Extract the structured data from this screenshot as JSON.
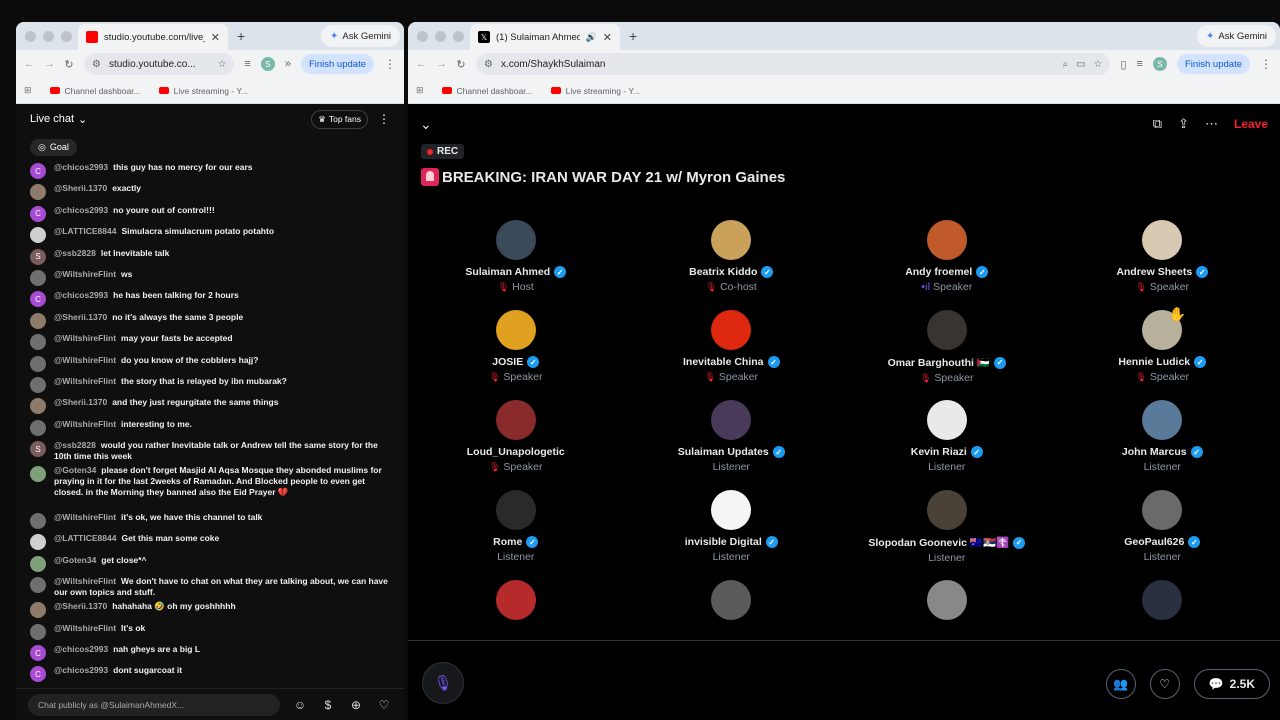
{
  "left_window": {
    "tab_title": "studio.youtube.com/live_chat",
    "gemini_label": "Ask Gemini",
    "url": "studio.youtube.co...",
    "profile_letter": "S",
    "finish_update": "Finish update",
    "bookmarks": [
      "Channel dashboar...",
      "Live streaming - Y..."
    ],
    "chat": {
      "header": "Live chat",
      "top_fans": "Top fans",
      "goal": "Goal",
      "input_placeholder": "Chat publicly as @SulaimanAhmedX...",
      "messages": [
        {
          "author": "@chicos2993",
          "text": "this guy has no mercy for our ears",
          "avatar_letter": "C",
          "avatar_color": "#a64bd2"
        },
        {
          "author": "@Sherii.1370",
          "text": "exactly",
          "avatar_letter": "",
          "avatar_color": "#8d7a68"
        },
        {
          "author": "@chicos2993",
          "text": "no youre out of control!!!",
          "avatar_letter": "C",
          "avatar_color": "#a64bd2"
        },
        {
          "author": "@LATTICE8844",
          "text": "Simulacra simulacrum potato potahto",
          "avatar_letter": "",
          "avatar_color": "#cfcfcf"
        },
        {
          "author": "@ssb2828",
          "text": "let Inevitable talk",
          "avatar_letter": "S",
          "avatar_color": "#7a5c5c"
        },
        {
          "author": "@WiltshireFlint",
          "text": "ws",
          "avatar_letter": "",
          "avatar_color": "#6f6f6f"
        },
        {
          "author": "@chicos2993",
          "text": "he has been talking for 2 hours",
          "avatar_letter": "C",
          "avatar_color": "#a64bd2"
        },
        {
          "author": "@Sherii.1370",
          "text": "no it's always the same 3 people",
          "avatar_letter": "",
          "avatar_color": "#8d7a68"
        },
        {
          "author": "@WiltshireFlint",
          "text": "may your fasts be accepted",
          "avatar_letter": "",
          "avatar_color": "#6f6f6f"
        },
        {
          "author": "@WiltshireFlint",
          "text": "do you know of the cobblers hajj?",
          "avatar_letter": "",
          "avatar_color": "#6f6f6f"
        },
        {
          "author": "@WiltshireFlint",
          "text": "the story that is relayed by ibn mubarak?",
          "avatar_letter": "",
          "avatar_color": "#6f6f6f"
        },
        {
          "author": "@Sherii.1370",
          "text": "and they just regurgitate the same things",
          "avatar_letter": "",
          "avatar_color": "#8d7a68"
        },
        {
          "author": "@WiltshireFlint",
          "text": "interesting to me.",
          "avatar_letter": "",
          "avatar_color": "#6f6f6f"
        },
        {
          "author": "@ssb2828",
          "text": "would you rather Inevitable talk or Andrew tell the same story for the 10th time this week",
          "avatar_letter": "S",
          "avatar_color": "#7a5c5c",
          "size": "two"
        },
        {
          "author": "@Goten34",
          "text": "please don't forget Masjid Al Aqsa Mosque they abonded muslims for praying in it for the last 2weeks of Ramadan. And Blocked people to even get closed. in the Morning they banned also the Eid Prayer 💔",
          "avatar_letter": "",
          "avatar_color": "#7fa07a",
          "size": "three"
        },
        {
          "author": "@WiltshireFlint",
          "text": "it's ok, we have this channel to talk",
          "avatar_letter": "",
          "avatar_color": "#6f6f6f"
        },
        {
          "author": "@LATTICE8844",
          "text": "Get this man some coke",
          "avatar_letter": "",
          "avatar_color": "#cfcfcf"
        },
        {
          "author": "@Goten34",
          "text": "get close*^",
          "avatar_letter": "",
          "avatar_color": "#7fa07a"
        },
        {
          "author": "@WiltshireFlint",
          "text": "We don't have to chat on what they are talking about, we can have our own topics and stuff.",
          "avatar_letter": "",
          "avatar_color": "#6f6f6f",
          "size": "two"
        },
        {
          "author": "@Sherii.1370",
          "text": "hahahaha 🤣 oh my goshhhhh",
          "avatar_letter": "",
          "avatar_color": "#8d7a68"
        },
        {
          "author": "@WiltshireFlint",
          "text": "It's ok",
          "avatar_letter": "",
          "avatar_color": "#6f6f6f"
        },
        {
          "author": "@chicos2993",
          "text": "nah gheys are a big L",
          "avatar_letter": "C",
          "avatar_color": "#a64bd2"
        },
        {
          "author": "@chicos2993",
          "text": "dont sugarcoat it",
          "avatar_letter": "C",
          "avatar_color": "#a64bd2"
        }
      ]
    }
  },
  "right_window": {
    "tab_title": "(1) Sulaiman Ahmed (@Sh",
    "gemini_label": "Ask Gemini",
    "url": "x.com/ShaykhSulaiman",
    "profile_letter": "S",
    "finish_update": "Finish update",
    "bookmarks": [
      "Channel dashboar...",
      "Live streaming - Y..."
    ],
    "space": {
      "rec_label": "REC",
      "title": "BREAKING: IRAN WAR DAY 21 w/ Myron Gaines",
      "leave_label": "Leave",
      "listener_count": "2.5K",
      "participants": [
        {
          "name": "Sulaiman Ahmed",
          "role": "Host",
          "muted": true,
          "verified": true,
          "color": "#3a4a5a"
        },
        {
          "name": "Beatrix Kiddo",
          "role": "Co-host",
          "muted": true,
          "verified": true,
          "color": "#c9a15a"
        },
        {
          "name": "Andy froemel",
          "role": "Speaker",
          "muted": false,
          "verified": true,
          "color": "#c05a2a"
        },
        {
          "name": "Andrew Sheets",
          "role": "Speaker",
          "muted": true,
          "verified": true,
          "color": "#d8c9b2"
        },
        {
          "name": "JOSIE",
          "role": "Speaker",
          "muted": true,
          "verified": true,
          "color": "#e0a020"
        },
        {
          "name": "Inevitable China",
          "role": "Speaker",
          "muted": true,
          "verified": true,
          "color": "#de2910"
        },
        {
          "name": "Omar Barghouthi 🇵🇸",
          "role": "Speaker",
          "muted": true,
          "verified": true,
          "color": "#3a3430"
        },
        {
          "name": "Hennie Ludick",
          "role": "Speaker",
          "muted": true,
          "verified": true,
          "color": "#b7b09a",
          "hand": true
        },
        {
          "name": "Loud_Unapologetic",
          "role": "Speaker",
          "muted": true,
          "verified": false,
          "color": "#8a2b2b"
        },
        {
          "name": "Sulaiman Updates",
          "role": "Listener",
          "muted": false,
          "verified": true,
          "color": "#4a3a5a"
        },
        {
          "name": "Kevin Riazi",
          "role": "Listener",
          "muted": false,
          "verified": true,
          "color": "#e9e9e9"
        },
        {
          "name": "John Marcus",
          "role": "Listener",
          "muted": false,
          "verified": true,
          "color": "#5a7a9a"
        },
        {
          "name": "Rome",
          "role": "Listener",
          "muted": false,
          "verified": true,
          "color": "#2a2a2a"
        },
        {
          "name": "invisible Digital",
          "role": "Listener",
          "muted": false,
          "verified": true,
          "color": "#f5f5f5"
        },
        {
          "name": "Slopodan Goonevic 🇦🇺🇷🇸☦️",
          "role": "Listener",
          "muted": false,
          "verified": true,
          "color": "#4a4236"
        },
        {
          "name": "GeoPaul626",
          "role": "Listener",
          "muted": false,
          "verified": true,
          "color": "#6a6a6a"
        },
        {
          "name": "",
          "role": "",
          "muted": false,
          "verified": false,
          "color": "#b52a2a"
        },
        {
          "name": "",
          "role": "",
          "muted": false,
          "verified": false,
          "color": "#5a5a5a"
        },
        {
          "name": "",
          "role": "",
          "muted": false,
          "verified": false,
          "color": "#888888"
        },
        {
          "name": "",
          "role": "",
          "muted": false,
          "verified": false,
          "color": "#2a3040"
        }
      ]
    }
  },
  "colors": {
    "youtube_red": "#ff0000",
    "x_red": "#f4212e",
    "verified_blue": "#1d9bf0",
    "mic_purple": "#7856ff"
  }
}
